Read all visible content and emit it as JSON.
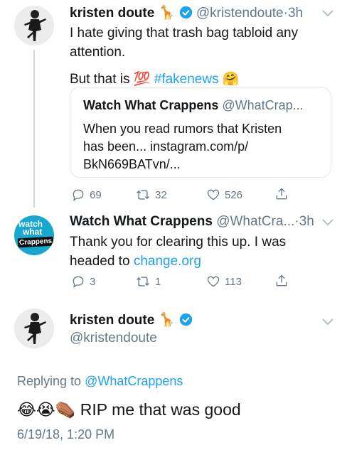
{
  "tweet1": {
    "display_name": "kristen doute",
    "handle": "@kristendoute",
    "time_sep": "·",
    "time": "3h",
    "line1": "I hate giving that trash bag tabloid any",
    "line2": "attention.",
    "line3_text": "But that is",
    "emoji_100": "💯",
    "hashtag": "#fakenews",
    "emoji_hug": "🤗",
    "emoji_giraffe": "🦒",
    "quote": {
      "display_name": "Watch What Crappens",
      "handle": "@WhatCrap...",
      "line1": "When you read rumors that Kristen",
      "line2": "has been... instagram.com/p/",
      "line3": "BkN669BATvn/..."
    },
    "actions": {
      "replies": "69",
      "retweets": "32",
      "likes": "526"
    }
  },
  "tweet2": {
    "display_name": "Watch What Crappens",
    "handle": "@WhatCra...",
    "time_sep": "·",
    "time": "3h",
    "line1": "Thank you for clearing this up. I was",
    "line2_text": "headed to",
    "link": "change.org",
    "avatar_text_1": "watch",
    "avatar_text_2": "what",
    "avatar_text_3": "Crappens",
    "actions": {
      "replies": "3",
      "retweets": "1",
      "likes": "113"
    }
  },
  "tweet3": {
    "display_name": "kristen doute",
    "emoji_giraffe": "🦒",
    "handle": "@kristendoute",
    "replying_prefix": "Replying to",
    "replying_to": "@WhatCrappens",
    "emojis": "😂😭⚰️",
    "text": "RIP me that was good",
    "timestamp": "6/19/18, 1:20 PM"
  },
  "colors": {
    "accent": "#1da1f2",
    "gray": "#657786",
    "border": "#e1e8ed",
    "wwc_brand": "#17a8cf"
  }
}
